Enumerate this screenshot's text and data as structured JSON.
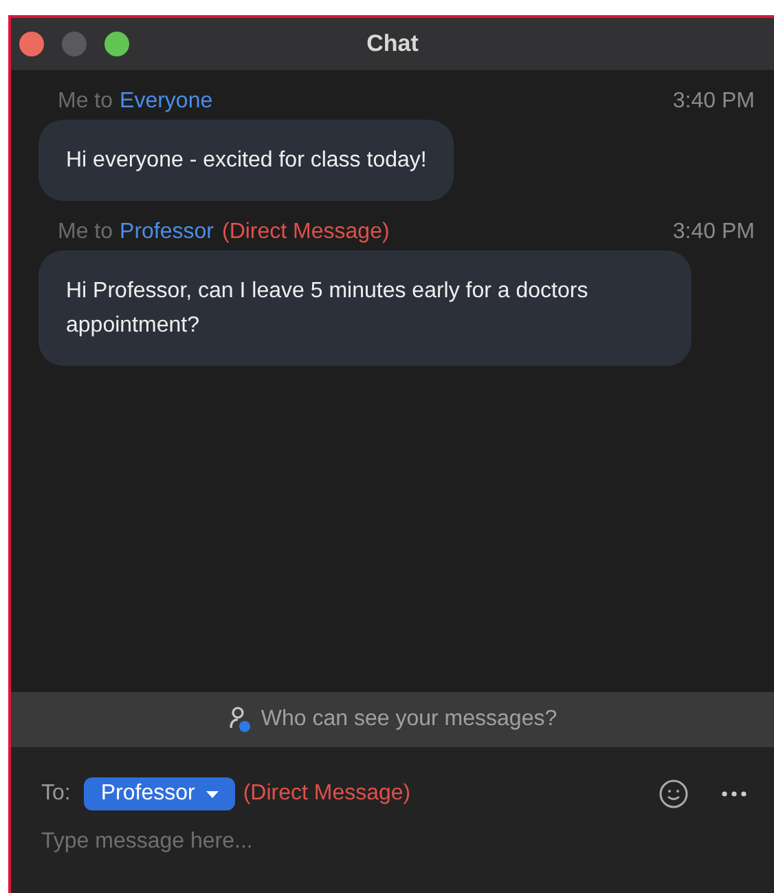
{
  "window": {
    "title": "Chat"
  },
  "messages": [
    {
      "sender": "Me to",
      "recipient": "Everyone",
      "time": "3:40 PM",
      "text": "Hi everyone - excited for class today!"
    },
    {
      "sender": "Me to",
      "recipient": "Professor",
      "direct_label": "(Direct Message)",
      "time": "3:40 PM",
      "text": "Hi Professor, can I leave 5 minutes early for a doctors appointment?"
    }
  ],
  "visibility_banner": {
    "text": "Who can see your messages?"
  },
  "compose": {
    "to_label": "To:",
    "recipient": "Professor",
    "direct_label": "(Direct Message)",
    "placeholder": "Type message here..."
  }
}
